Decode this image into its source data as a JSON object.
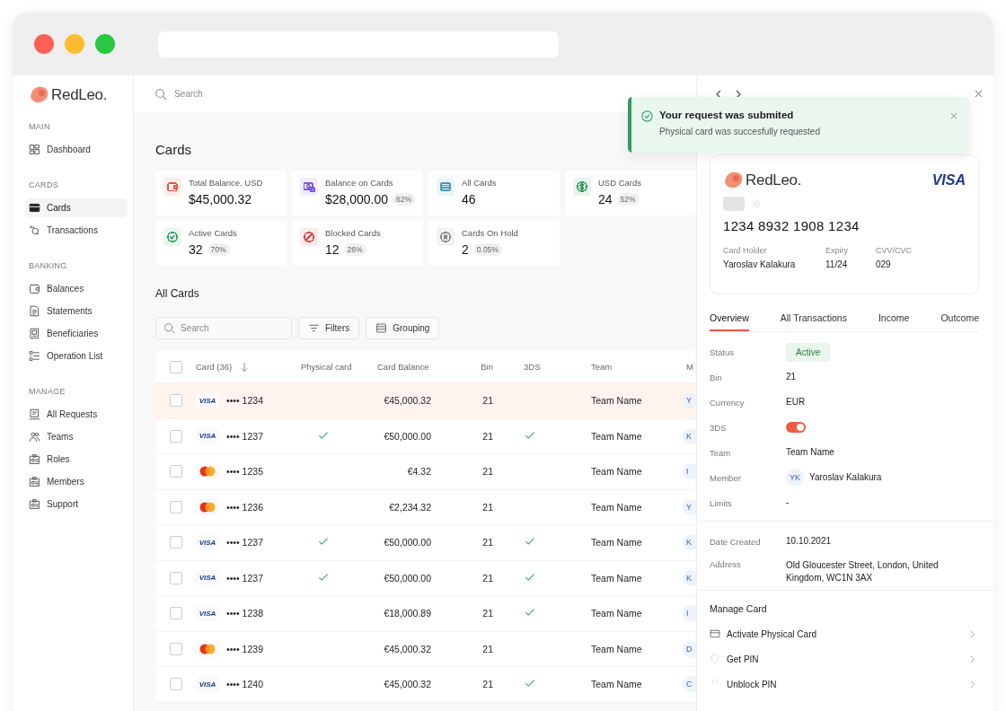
{
  "sidebar": {
    "logo": "RedLeo.",
    "sections": [
      {
        "title": "MAIN",
        "items": [
          {
            "label": "Dashboard",
            "selected": false
          }
        ]
      },
      {
        "title": "CARDS",
        "items": [
          {
            "label": "Cards",
            "selected": true
          },
          {
            "label": "Transactions",
            "selected": false
          }
        ]
      },
      {
        "title": "BANKING",
        "items": [
          {
            "label": "Balances",
            "selected": false
          },
          {
            "label": "Statements",
            "selected": false
          },
          {
            "label": "Beneficiaries",
            "selected": false
          },
          {
            "label": "Operation List",
            "selected": false
          }
        ]
      },
      {
        "title": "MANAGE",
        "items": [
          {
            "label": "All Requests",
            "selected": false
          },
          {
            "label": "Teams",
            "selected": false
          },
          {
            "label": "Roles",
            "selected": false
          },
          {
            "label": "Members",
            "selected": false
          },
          {
            "label": "Support",
            "selected": false
          }
        ]
      }
    ]
  },
  "search": {
    "placeholder": "Search"
  },
  "page_title": "Cards",
  "stats": [
    {
      "label": "Total Balance, USD",
      "value": "$45,000.32",
      "color": "#e8573f"
    },
    {
      "label": "Balance on Cards",
      "value": "$28,000.00",
      "percent": "62%",
      "color": "#7b5ce6"
    },
    {
      "label": "All Cards",
      "value": "46",
      "color": "#4a9bb0"
    },
    {
      "label": "USD Cards",
      "value": "24",
      "percent": "52%",
      "color": "#2f9e5f"
    },
    {
      "label": "Active Cards",
      "value": "32",
      "percent": "70%",
      "color": "#3aa466"
    },
    {
      "label": "Blocked Cards",
      "value": "12",
      "percent": "26%",
      "color": "#d9463e"
    },
    {
      "label": "Cards On Hold",
      "value": "2",
      "percent": "0.05%",
      "color": "#8a8a8a"
    }
  ],
  "all_cards": {
    "title": "All Cards",
    "search": {
      "placeholder": "Search"
    },
    "buttons": [
      "Filters",
      "Grouping"
    ],
    "table": {
      "select_all_checked": false,
      "columns": [
        "Card (36)",
        "Physical card",
        "Card Balance",
        "Bin",
        "3DS",
        "Team",
        "M"
      ],
      "rows": [
        {
          "selected": true,
          "checked": false,
          "kind": "visa",
          "logo_text": "VISA",
          "number": "•••• 1234",
          "physical": false,
          "balance": "€45,000.32",
          "bin": "21",
          "three_ds": false,
          "team": "Team Name",
          "member": "Y"
        },
        {
          "selected": false,
          "checked": false,
          "kind": "visa",
          "logo_text": "VISA",
          "number": "•••• 1237",
          "physical": true,
          "balance": "€50,000.00",
          "bin": "21",
          "three_ds": true,
          "team": "Team Name",
          "member": "K"
        },
        {
          "selected": false,
          "checked": false,
          "kind": "mastercard",
          "number": "•••• 1235",
          "physical": false,
          "balance": "€4.32",
          "bin": "21",
          "three_ds": false,
          "team": "Team Name",
          "member": "I"
        },
        {
          "selected": false,
          "checked": false,
          "kind": "mastercard",
          "number": "•••• 1236",
          "physical": false,
          "balance": "€2,234.32",
          "bin": "21",
          "three_ds": false,
          "team": "Team Name",
          "member": "Y"
        },
        {
          "selected": false,
          "checked": false,
          "kind": "visa",
          "logo_text": "VISA",
          "number": "•••• 1237",
          "physical": true,
          "balance": "€50,000.00",
          "bin": "21",
          "three_ds": true,
          "team": "Team Name",
          "member": "K"
        },
        {
          "selected": false,
          "checked": false,
          "kind": "visa",
          "logo_text": "VISA",
          "number": "•••• 1237",
          "physical": true,
          "balance": "€50,000.00",
          "bin": "21",
          "three_ds": true,
          "team": "Team Name",
          "member": "K"
        },
        {
          "selected": false,
          "checked": false,
          "kind": "visa",
          "logo_text": "VISA",
          "number": "•••• 1238",
          "physical": false,
          "balance": "€18,000.89",
          "bin": "21",
          "three_ds": true,
          "team": "Team Name",
          "member": "I"
        },
        {
          "selected": false,
          "checked": false,
          "kind": "mastercard",
          "number": "•••• 1239",
          "physical": false,
          "balance": "€45,000.32",
          "bin": "21",
          "three_ds": false,
          "team": "Team Name",
          "member": "D"
        },
        {
          "selected": false,
          "checked": false,
          "kind": "visa",
          "logo_text": "VISA",
          "number": "•••• 1240",
          "physical": false,
          "balance": "€45,000.32",
          "bin": "21",
          "three_ds": true,
          "team": "Team Name",
          "member": "C"
        }
      ]
    }
  },
  "detail": {
    "card": {
      "logo": "RedLeo.",
      "brand": "VISA",
      "number": "1234 8932 1908 1234",
      "fields": [
        {
          "label": "Card Holder",
          "value": "Yaroslav Kalakura"
        },
        {
          "label": "Expiry",
          "value": "11/24"
        },
        {
          "label": "CVV/CVC",
          "value": "029"
        }
      ]
    },
    "tabs": [
      {
        "label": "Overview",
        "selected": true
      },
      {
        "label": "All Transactions",
        "selected": false
      },
      {
        "label": "Income",
        "selected": false
      },
      {
        "label": "Outcome",
        "selected": false
      }
    ],
    "groups": [
      [
        {
          "kind": "badge",
          "label": "Status",
          "value": "Active"
        },
        {
          "kind": "text",
          "label": "Bin",
          "value": "21"
        },
        {
          "kind": "text",
          "label": "Currency",
          "value": "EUR"
        },
        {
          "kind": "toggle",
          "label": "3DS",
          "on": true
        },
        {
          "kind": "text",
          "label": "Team",
          "value": "Team Name"
        },
        {
          "kind": "member",
          "label": "Member",
          "initials": "YK",
          "value": "Yaroslav Kalakura"
        },
        {
          "kind": "text",
          "label": "Limits",
          "value": "-"
        }
      ],
      [
        {
          "kind": "text",
          "label": "Date Created",
          "value": "10.10.2021"
        },
        {
          "kind": "text",
          "label": "Address",
          "value": "Old Gloucester Street, London, United Kingdom, WC1N 3AX"
        }
      ]
    ],
    "manage": {
      "title": "Manage Card",
      "actions": [
        "Activate Physical Card",
        "Get PIN",
        "Unblock PIN"
      ]
    }
  },
  "toast": {
    "title": "Your request was submited",
    "message": "Physical card was succesfully requested"
  }
}
